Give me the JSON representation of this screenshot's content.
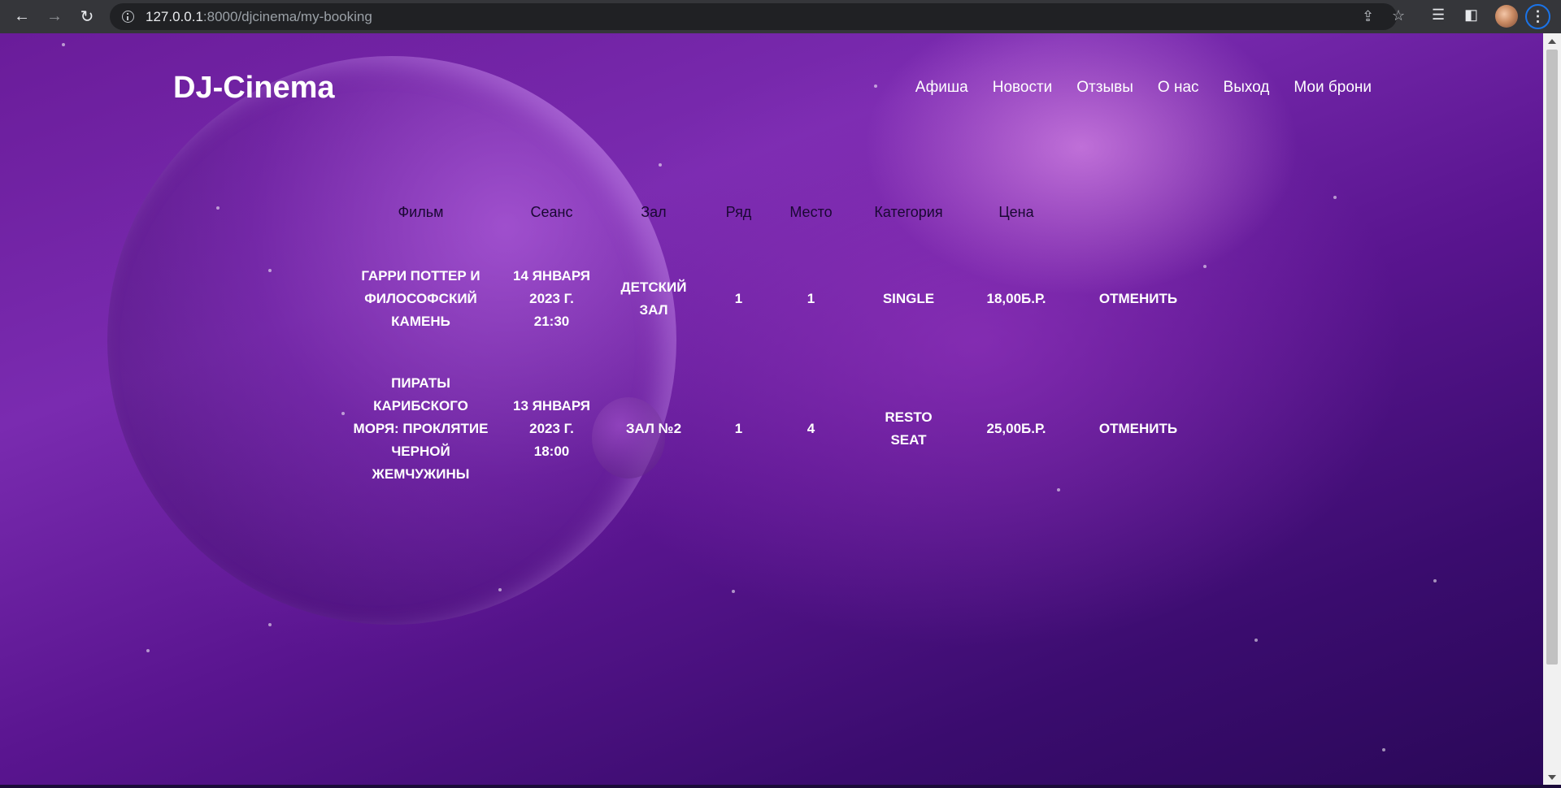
{
  "browser": {
    "url_host": "127.0.0.1",
    "url_rest": ":8000/djcinema/my-booking"
  },
  "site": {
    "logo": "DJ-Cinema",
    "nav": [
      "Афиша",
      "Новости",
      "Отзывы",
      "О нас",
      "Выход",
      "Мои брони"
    ]
  },
  "table": {
    "headers": [
      "Фильм",
      "Сеанс",
      "Зал",
      "Ряд",
      "Место",
      "Категория",
      "Цена"
    ],
    "rows": [
      {
        "film": "Гарри Поттер и философский камень",
        "session": "14 января 2023 г. 21:30",
        "hall": "Детский зал",
        "row": "1",
        "seat": "1",
        "category": "Single",
        "price": "18,00б.р.",
        "action": "Отменить"
      },
      {
        "film": "Пираты Карибского моря: Проклятие Черной жемчужины",
        "session": "13 января 2023 г. 18:00",
        "hall": "Зал №2",
        "row": "1",
        "seat": "4",
        "category": "Resto Seat",
        "price": "25,00б.р.",
        "action": "Отменить"
      }
    ]
  }
}
